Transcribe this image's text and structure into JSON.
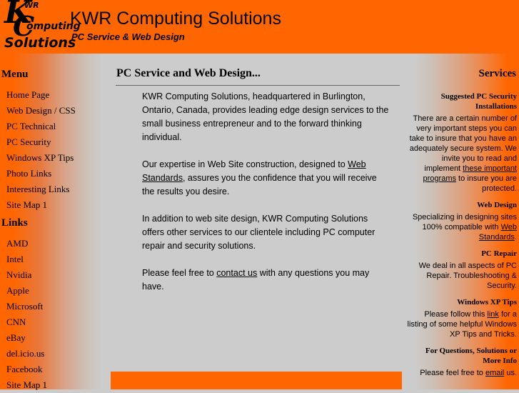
{
  "header": {
    "logo": {
      "k": "K",
      "wr": "WR",
      "c": "C",
      "omputing": "omputing",
      "solutions": "Solutions"
    },
    "title": "KWR Computing Solutions",
    "subtitle": "PC Service & Web Design"
  },
  "colors": {
    "accent_orange": "#ff6600",
    "page_gray": "#cccccc",
    "text_black": "#000000",
    "rule_gray": "#666666"
  },
  "sidebar_left": {
    "menu_heading": "Menu",
    "menu_items": [
      {
        "label": "Home Page"
      },
      {
        "label": "Web Design / CSS"
      },
      {
        "label": "PC Technical"
      },
      {
        "label": "PC Security"
      },
      {
        "label": "Windows XP Tips"
      },
      {
        "label": "Photo Links"
      },
      {
        "label": "Interesting Links"
      },
      {
        "label": "Site Map 1"
      }
    ],
    "links_heading": "Links",
    "links_items": [
      {
        "label": "AMD"
      },
      {
        "label": "Intel"
      },
      {
        "label": "Nvidia"
      },
      {
        "label": "Apple"
      },
      {
        "label": "Microsoft"
      },
      {
        "label": "CNN"
      },
      {
        "label": "eBay"
      },
      {
        "label": "del.icio.us"
      },
      {
        "label": "Facebook"
      },
      {
        "label": "Site Map 1"
      }
    ]
  },
  "main": {
    "heading": "PC Service and Web Design...",
    "paragraph1": "KWR Computing Solutions, headquartered in Burlington, Ontario, Canada, provides leading edge design services to the small business entrepreneur and to the forward thinking individual.",
    "paragraph2_pre": "Our expertise in Web Site construction, designed to ",
    "paragraph2_link": "Web Standards",
    "paragraph2_post": ", assures you the confidence that you will receive the results you desire.",
    "paragraph3": "In addition to web site design, KWR Computing Solutions offers other services to our clientele including PC computer repair and security solutions.",
    "paragraph4_pre": "Please feel free to ",
    "paragraph4_link": "contact us",
    "paragraph4_post": " with any questions you may have."
  },
  "sidebar_right": {
    "heading": "Services",
    "sections": [
      {
        "title": "Suggested PC Security Installations",
        "text_pre": "There are a certain number of very important steps you can take to insure that you have an adequately secure system. We invite you to read and implement ",
        "link": "these important programs",
        "text_post": " to insure you are protected."
      },
      {
        "title": "Web Design",
        "text_pre": "Specializing in designing sites 100% compatible with ",
        "link": "Web Standards",
        "text_post": "."
      },
      {
        "title": "PC Repair",
        "text_pre": "We deal in all aspects of PC Repair. Troubleshooting & Security.",
        "link": "",
        "text_post": ""
      },
      {
        "title": "Windows XP Tips",
        "text_pre": "Please follow this ",
        "link": "link",
        "text_post": " for a listing of some helpful Windows XP Tips and Tricks."
      },
      {
        "title": "For Questions, Solutions or More Info",
        "text_pre": "Please feel free to ",
        "link": "email",
        "text_post": " us."
      }
    ]
  }
}
